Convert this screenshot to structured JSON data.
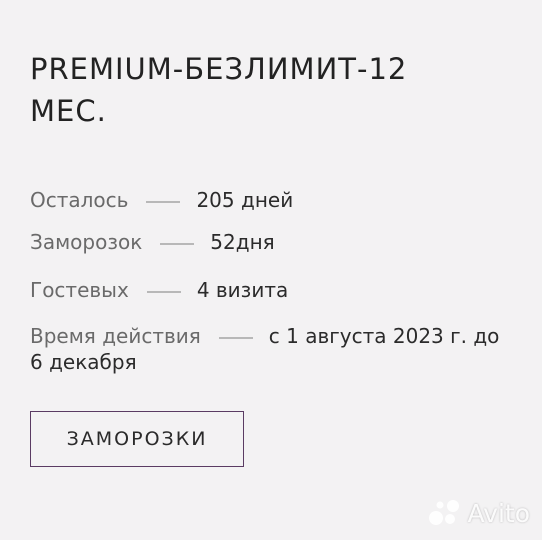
{
  "card": {
    "title": "PREMIUM-БЕЗЛИМИТ-12 МЕС.",
    "rows": [
      {
        "label": "Осталось",
        "value": "205 дней"
      },
      {
        "label": "Заморозок",
        "value": "52дня"
      },
      {
        "label": "Гостевых",
        "value": "4 визита"
      },
      {
        "label": "Время действия",
        "value": "с 1 августа 2023 г. до 6 декабря"
      }
    ],
    "freeze_button_label": "ЗАМОРОЗКИ"
  },
  "watermark": {
    "brand": "Avito",
    "icon": "avito-logo-icon"
  },
  "colors": {
    "background": "#f3f2f3",
    "button_border": "#5a3b63",
    "dash": "#b8b8b8"
  }
}
